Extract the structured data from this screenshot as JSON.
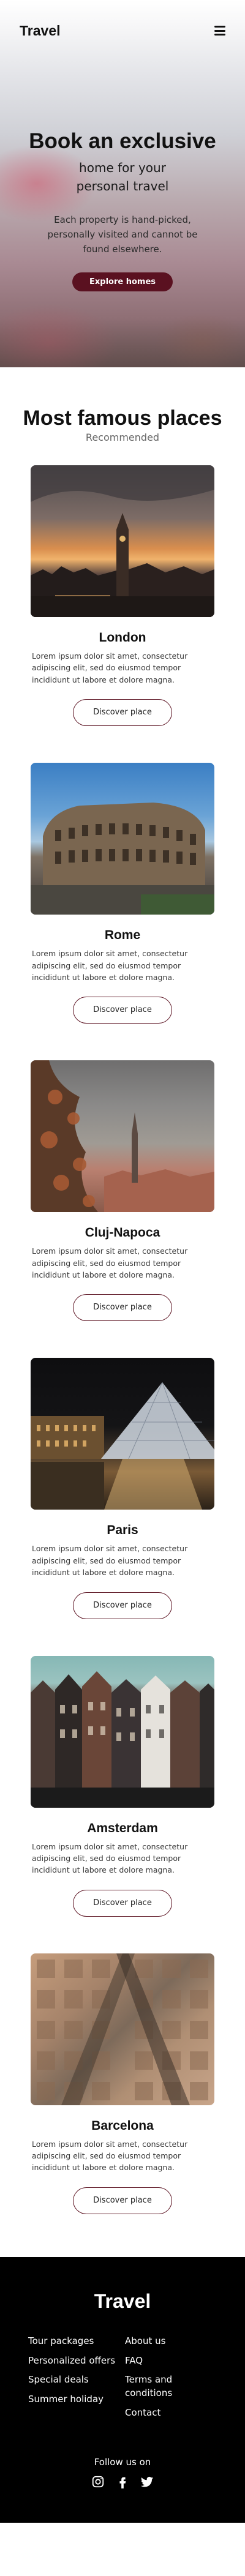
{
  "header": {
    "logo": "Travel"
  },
  "hero": {
    "title": "Book an exclusive",
    "subtitle": "home for your personal travel",
    "description": "Each property is hand-picked, personally visited and cannot be found elsewhere.",
    "button": "Explore homes"
  },
  "places_section": {
    "title": "Most famous places",
    "subtitle": "Recommended",
    "button_label": "Discover place",
    "items": [
      {
        "name": "London",
        "description": "Lorem ipsum dolor sit amet, consectetur adipiscing elit, sed do eiusmod tempor incididunt ut labore et dolore magna."
      },
      {
        "name": "Rome",
        "description": "Lorem ipsum dolor sit amet, consectetur adipiscing elit, sed do eiusmod tempor incididunt ut labore et dolore magna."
      },
      {
        "name": "Cluj-Napoca",
        "description": "Lorem ipsum dolor sit amet, consectetur adipiscing elit, sed do eiusmod tempor incididunt ut labore et dolore magna."
      },
      {
        "name": "Paris",
        "description": "Lorem ipsum dolor sit amet, consectetur adipiscing elit, sed do eiusmod tempor incididunt ut labore et dolore magna."
      },
      {
        "name": "Amsterdam",
        "description": "Lorem ipsum dolor sit amet, consectetur adipiscing elit, sed do eiusmod tempor incididunt ut labore et dolore magna."
      },
      {
        "name": "Barcelona",
        "description": "Lorem ipsum dolor sit amet, consectetur adipiscing elit, sed do eiusmod tempor incididunt ut labore et dolore magna."
      }
    ]
  },
  "footer": {
    "title": "Travel",
    "col1": [
      "Tour packages",
      "Personalized offers",
      "Special deals",
      "Summer holiday"
    ],
    "col2": [
      "About us",
      "FAQ",
      "Terms and conditions",
      "Contact"
    ],
    "follow": "Follow us on",
    "socials": [
      "instagram-icon",
      "facebook-icon",
      "twitter-icon"
    ]
  },
  "colors": {
    "accent": "#5a1120",
    "footer_bg": "#000000"
  }
}
